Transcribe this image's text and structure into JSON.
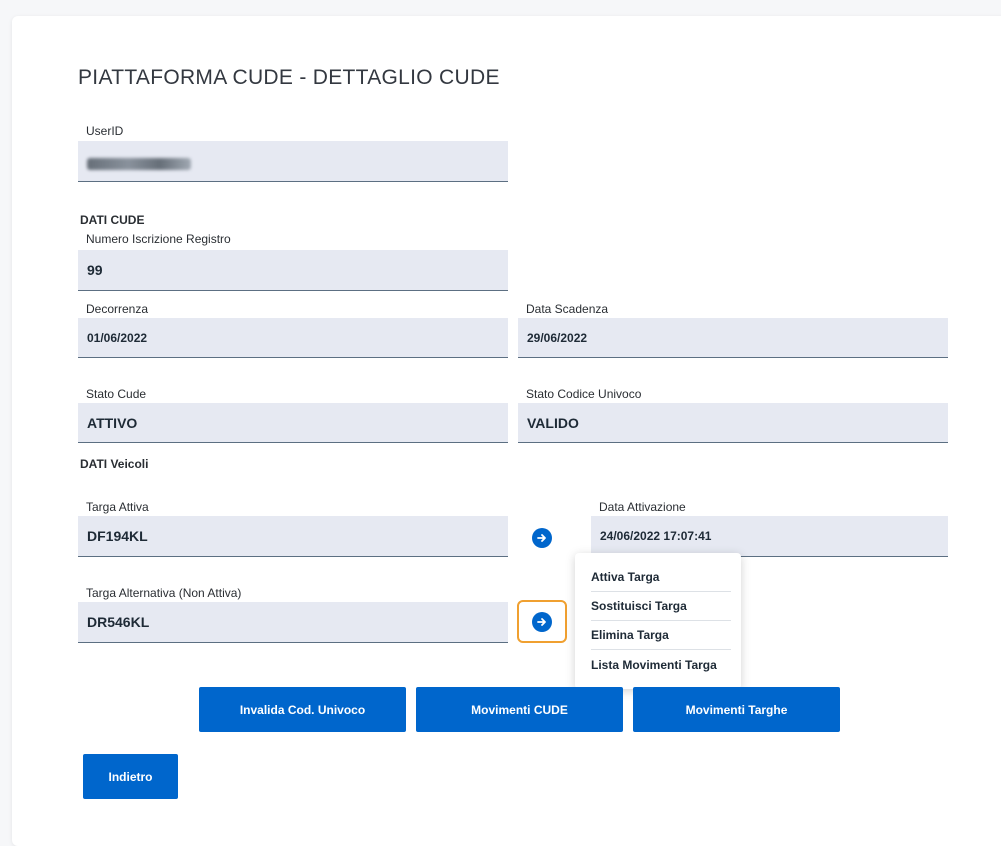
{
  "page": {
    "title": "PIATTAFORMA CUDE - DETTAGLIO CUDE"
  },
  "user": {
    "label": "UserID",
    "value": ""
  },
  "dati_cude": {
    "section_label": "DATI CUDE",
    "numero_iscrizione": {
      "label": "Numero Iscrizione Registro",
      "value": "99"
    },
    "decorrenza": {
      "label": "Decorrenza",
      "value": "01/06/2022"
    },
    "data_scadenza": {
      "label": "Data Scadenza",
      "value": "29/06/2022"
    },
    "stato_cude": {
      "label": "Stato Cude",
      "value": "ATTIVO"
    },
    "stato_codice_univoco": {
      "label": "Stato Codice Univoco",
      "value": "VALIDO"
    }
  },
  "dati_veicoli": {
    "section_label": "DATI Veicoli",
    "targa_attiva": {
      "label": "Targa Attiva",
      "value": "DF194KL"
    },
    "data_attivazione": {
      "label": "Data Attivazione",
      "value": "24/06/2022 17:07:41"
    },
    "targa_alternativa": {
      "label": "Targa Alternativa (Non Attiva)",
      "value": "DR546KL"
    }
  },
  "menu": {
    "items": [
      {
        "label": "Attiva Targa"
      },
      {
        "label": "Sostituisci Targa"
      },
      {
        "label": "Elimina Targa"
      },
      {
        "label": "Lista Movimenti Targa"
      }
    ]
  },
  "actions": {
    "invalida": "Invalida Cod. Univoco",
    "movimenti_cude": "Movimenti CUDE",
    "movimenti_targhe": "Movimenti Targhe",
    "indietro": "Indietro"
  },
  "icons": {
    "action_arrow": "arrow-right-circle-icon"
  },
  "colors": {
    "primary": "#0066cc",
    "field_background": "#e6e9f2",
    "focus_ring": "#f0a030"
  }
}
